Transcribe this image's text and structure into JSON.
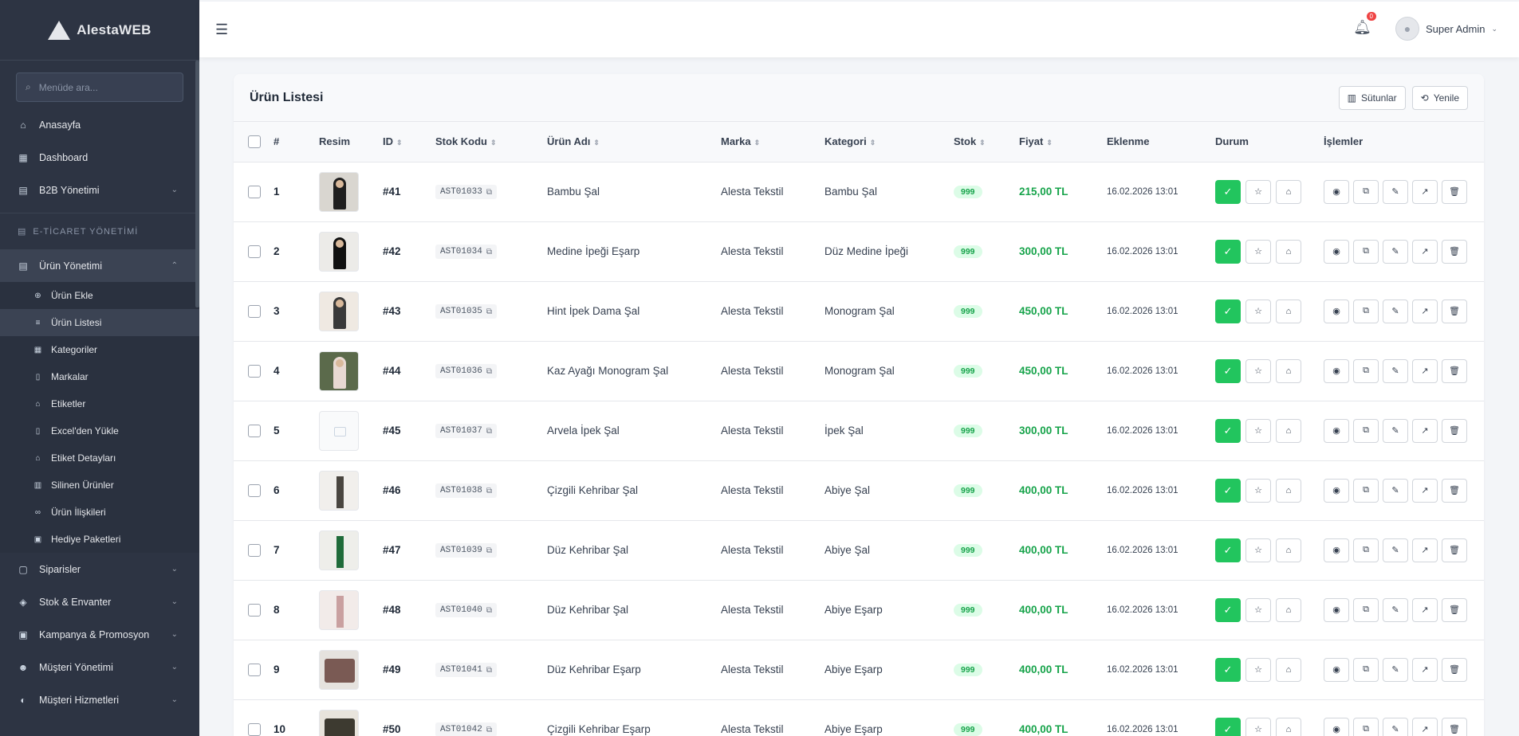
{
  "app": {
    "logo_text": "AlestaWEB"
  },
  "sidebar": {
    "search_placeholder": "Menüde ara...",
    "items_top": [
      {
        "icon": "home-icon",
        "glyph": "⌂",
        "label": "Anasayfa"
      },
      {
        "icon": "grid-icon",
        "glyph": "▦",
        "label": "Dashboard"
      },
      {
        "icon": "building-icon",
        "glyph": "▤",
        "label": "B2B Yönetimi",
        "chevron": true
      }
    ],
    "section": "E-TİCARET YÖNETİMİ",
    "product_mgmt": {
      "label": "Ürün Yönetimi"
    },
    "sub_items": [
      {
        "icon": "plus-circle-icon",
        "glyph": "⊕",
        "label": "Ürün Ekle"
      },
      {
        "icon": "list-icon",
        "glyph": "≡",
        "label": "Ürün Listesi",
        "active": true
      },
      {
        "icon": "grid-icon",
        "glyph": "▦",
        "label": "Kategoriler"
      },
      {
        "icon": "bookmark-icon",
        "glyph": "▯",
        "label": "Markalar"
      },
      {
        "icon": "tag-icon",
        "glyph": "⌂",
        "label": "Etiketler"
      },
      {
        "icon": "file-icon",
        "glyph": "▯",
        "label": "Excel'den Yükle"
      },
      {
        "icon": "tag-icon",
        "glyph": "⌂",
        "label": "Etiket Detayları"
      },
      {
        "icon": "trash-icon",
        "glyph": "▥",
        "label": "Silinen Ürünler"
      },
      {
        "icon": "link-icon",
        "glyph": "∞",
        "label": "Ürün İlişkileri"
      },
      {
        "icon": "gift-icon",
        "glyph": "▣",
        "label": "Hediye Paketleri"
      }
    ],
    "items_bottom": [
      {
        "icon": "bag-icon",
        "glyph": "▢",
        "label": "Siparisler"
      },
      {
        "icon": "box-icon",
        "glyph": "◈",
        "label": "Stok & Envanter"
      },
      {
        "icon": "gift-icon",
        "glyph": "▣",
        "label": "Kampanya & Promosyon"
      },
      {
        "icon": "users-icon",
        "glyph": "☻",
        "label": "Müşteri Yönetimi"
      },
      {
        "icon": "headset-icon",
        "glyph": "◐",
        "label": "Müşteri Hizmetleri"
      }
    ]
  },
  "header": {
    "notification_count": "0",
    "user_name": "Super Admin"
  },
  "page": {
    "title": "Ürün Listesi",
    "columns_button": "Sütunlar",
    "refresh_button": "Yenile"
  },
  "table": {
    "headers": {
      "num": "#",
      "image": "Resim",
      "id": "ID",
      "sku": "Stok Kodu",
      "name": "Ürün Adı",
      "brand": "Marka",
      "category": "Kategori",
      "stock": "Stok",
      "price": "Fiyat",
      "added": "Eklenme",
      "status": "Durum",
      "actions": "İşlemler"
    },
    "rows": [
      {
        "num": "1",
        "id": "#41",
        "sku": "AST01033",
        "name": "Bambu Şal",
        "brand": "Alesta Tekstil",
        "category": "Bambu Şal",
        "stock": "999",
        "price": "215,00 TL",
        "added": "16.02.2026 13:01",
        "thumb": {
          "kind": "person",
          "bg": "#d9d6d0",
          "fg": "#1f1f1f"
        }
      },
      {
        "num": "2",
        "id": "#42",
        "sku": "AST01034",
        "name": "Medine İpeği Eşarp",
        "brand": "Alesta Tekstil",
        "category": "Düz Medine İpeği",
        "stock": "999",
        "price": "300,00 TL",
        "added": "16.02.2026 13:01",
        "thumb": {
          "kind": "person",
          "bg": "#ecebe8",
          "fg": "#111111"
        }
      },
      {
        "num": "3",
        "id": "#43",
        "sku": "AST01035",
        "name": "Hint İpek Dama Şal",
        "brand": "Alesta Tekstil",
        "category": "Monogram Şal",
        "stock": "999",
        "price": "450,00 TL",
        "added": "16.02.2026 13:01",
        "thumb": {
          "kind": "person",
          "bg": "#efe9e2",
          "fg": "#3a3a3a"
        }
      },
      {
        "num": "4",
        "id": "#44",
        "sku": "AST01036",
        "name": "Kaz Ayağı Monogram Şal",
        "brand": "Alesta Tekstil",
        "category": "Monogram Şal",
        "stock": "999",
        "price": "450,00 TL",
        "added": "16.02.2026 13:01",
        "thumb": {
          "kind": "person",
          "bg": "#5b6a4b",
          "fg": "#e8d9d2"
        }
      },
      {
        "num": "5",
        "id": "#45",
        "sku": "AST01037",
        "name": "Arvela İpek Şal",
        "brand": "Alesta Tekstil",
        "category": "İpek Şal",
        "stock": "999",
        "price": "300,00 TL",
        "added": "16.02.2026 13:01",
        "thumb": {
          "kind": "empty"
        }
      },
      {
        "num": "6",
        "id": "#46",
        "sku": "AST01038",
        "name": "Çizgili Kehribar Şal",
        "brand": "Alesta Tekstil",
        "category": "Abiye Şal",
        "stock": "999",
        "price": "400,00 TL",
        "added": "16.02.2026 13:01",
        "thumb": {
          "kind": "scarf",
          "bg": "#f1efec",
          "fg": "#4a4640"
        }
      },
      {
        "num": "7",
        "id": "#47",
        "sku": "AST01039",
        "name": "Düz Kehribar Şal",
        "brand": "Alesta Tekstil",
        "category": "Abiye Şal",
        "stock": "999",
        "price": "400,00 TL",
        "added": "16.02.2026 13:01",
        "thumb": {
          "kind": "scarf",
          "bg": "#eeeeea",
          "fg": "#1f6b3a"
        }
      },
      {
        "num": "8",
        "id": "#48",
        "sku": "AST01040",
        "name": "Düz Kehribar Şal",
        "brand": "Alesta Tekstil",
        "category": "Abiye Eşarp",
        "stock": "999",
        "price": "400,00 TL",
        "added": "16.02.2026 13:01",
        "thumb": {
          "kind": "scarf",
          "bg": "#f2ebe9",
          "fg": "#c9a0a0"
        }
      },
      {
        "num": "9",
        "id": "#49",
        "sku": "AST01041",
        "name": "Düz Kehribar Eşarp",
        "brand": "Alesta Tekstil",
        "category": "Abiye Eşarp",
        "stock": "999",
        "price": "400,00 TL",
        "added": "16.02.2026 13:01",
        "thumb": {
          "kind": "fold",
          "bg": "#e5e2de",
          "fg": "#7a5a54"
        }
      },
      {
        "num": "10",
        "id": "#50",
        "sku": "AST01042",
        "name": "Çizgili Kehribar Eşarp",
        "brand": "Alesta Tekstil",
        "category": "Abiye Eşarp",
        "stock": "999",
        "price": "400,00 TL",
        "added": "16.02.2026 13:01",
        "thumb": {
          "kind": "fold",
          "bg": "#e8e4dc",
          "fg": "#3d3a30"
        }
      }
    ]
  },
  "colors": {
    "sidebar_bg": "#2d3443",
    "accent_green": "#22c55e",
    "price_green": "#16a34a",
    "badge_red": "#ef4444"
  }
}
